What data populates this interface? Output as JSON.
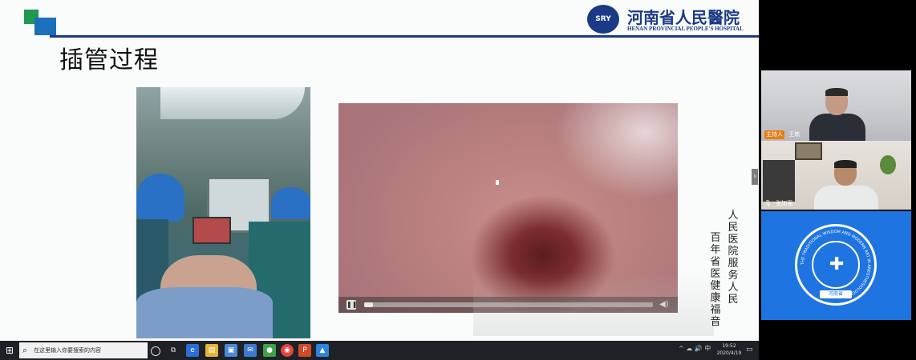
{
  "slide": {
    "title": "插管过程",
    "hospital_name_cn": "河南省人民醫院",
    "hospital_name_en": "HENAN PROVINCIAL PEOPLE'S HOSPITAL",
    "hospital_emblem_text": "SRY",
    "poem_columns": [
      "人民医院服务人民",
      "百年省医健康福音"
    ],
    "video": {
      "progress": 0.03
    }
  },
  "taskbar": {
    "search_placeholder": "在这里输入你要搜索的内容",
    "time": "19:52",
    "date": "2020/4/19",
    "tray_text": "^ ☁ 🔊 中"
  },
  "participants": [
    {
      "role_badge": "主持人",
      "name": "王炼"
    },
    {
      "name": "张加强"
    }
  ],
  "emblem": {
    "ring_text": "THE TRADITIONAL WISDOM AND MODERN ART IN ANESTHESIOLOGY",
    "banner_text": "河南省"
  },
  "colors": {
    "brand_blue": "#1a3a86",
    "accent_green": "#1f9a4e",
    "tile_blue": "#1e74e0",
    "host_badge": "#e67d14"
  }
}
